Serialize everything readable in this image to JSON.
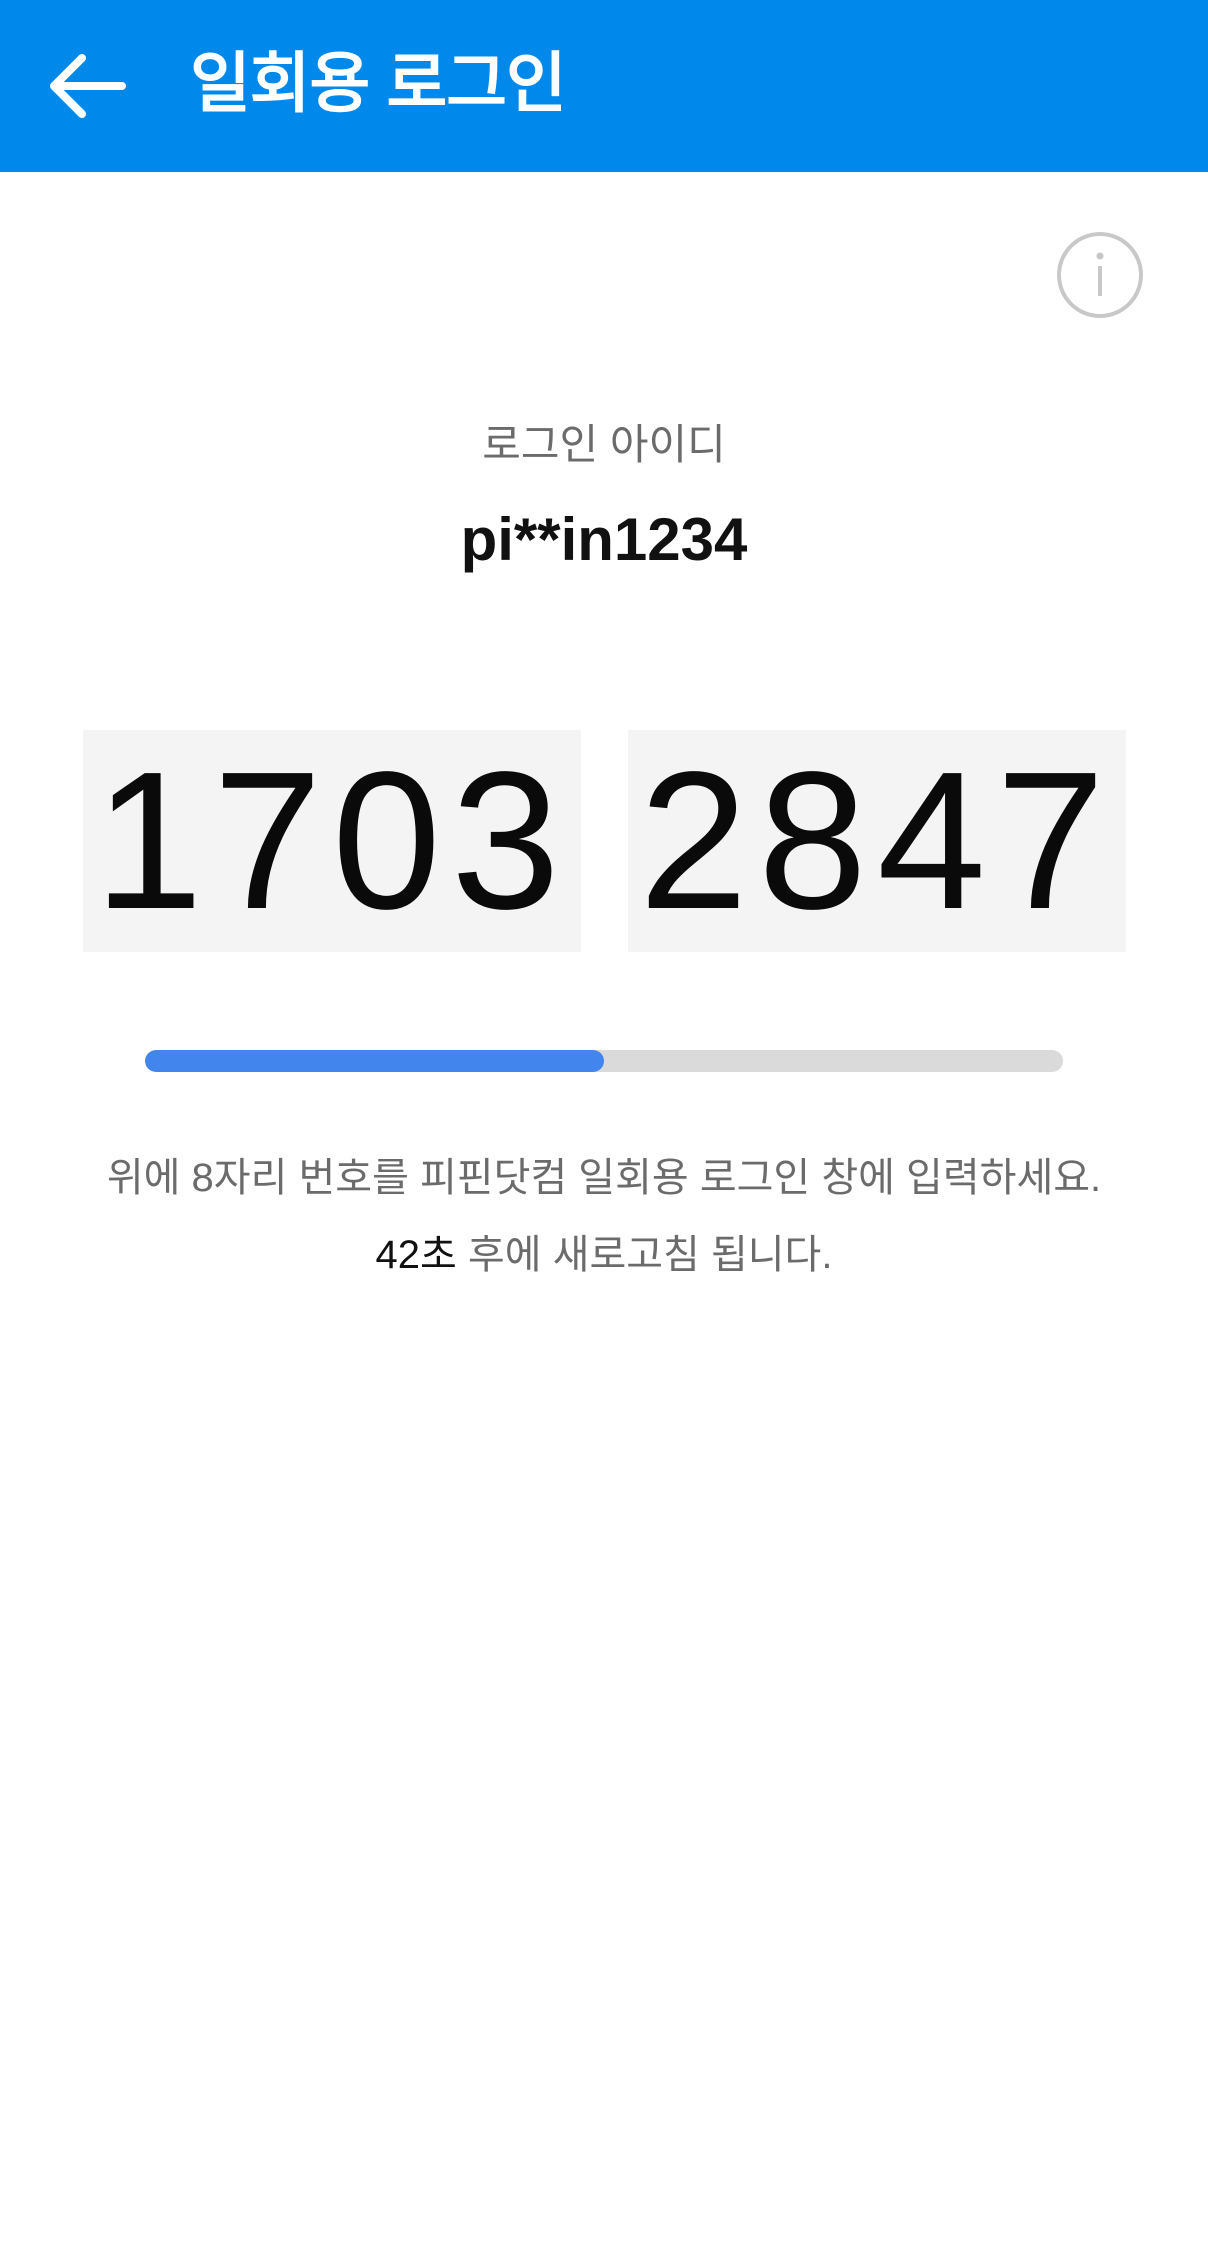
{
  "appbar": {
    "title": "일회용 로그인",
    "background_color": "#0089ea",
    "back_icon": "arrow-left-icon"
  },
  "info": {
    "icon": "info-icon",
    "color": "#c8c8c8"
  },
  "login_id": {
    "label": "로그인 아이디",
    "value": "pi**in1234"
  },
  "code": {
    "first": "1703",
    "second": "2847"
  },
  "progress": {
    "fraction": 0.5,
    "fill_color": "#4285ec",
    "track_color": "#dadada"
  },
  "instructions": {
    "text": "위에 8자리 번호를 피핀닷컴 일회용 로그인 창에 입력하세요.",
    "refresh_count": "42초",
    "refresh_suffix": " 후에 새로고침 됩니다."
  }
}
